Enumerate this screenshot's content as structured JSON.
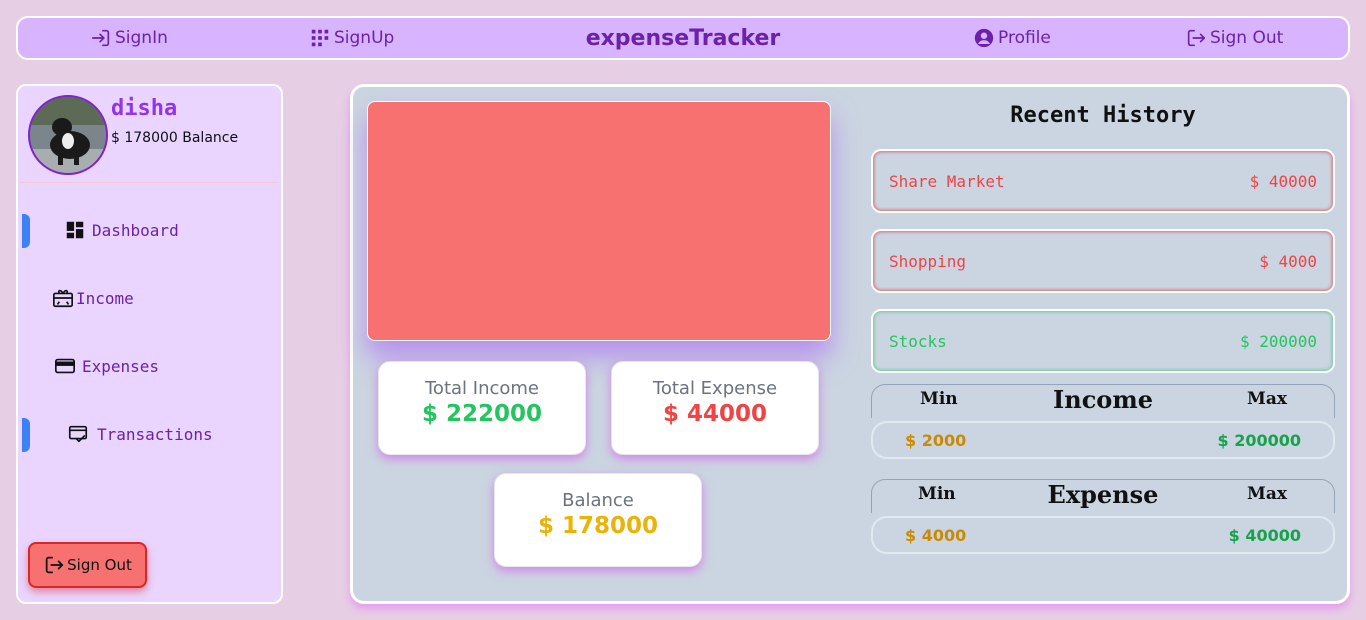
{
  "nav": {
    "signin": "SignIn",
    "signup": "SignUp",
    "brand": "expenseTracker",
    "profile": "Profile",
    "signout": "Sign Out"
  },
  "sidebar": {
    "user_name": "disha",
    "balance_text": "$ 178000 Balance",
    "items": [
      {
        "label": "Dashboard",
        "icon": "dashboard-icon",
        "active": true
      },
      {
        "label": "Income",
        "icon": "gift-card-icon",
        "active": false
      },
      {
        "label": "Expenses",
        "icon": "credit-card-icon",
        "active": false
      },
      {
        "label": "Transactions",
        "icon": "receipt-check-icon",
        "active": true
      }
    ],
    "signout_label": "Sign Out"
  },
  "stats": {
    "income_label": "Total Income",
    "income_value": "$ 222000",
    "expense_label": "Total Expense",
    "expense_value": "$ 44000",
    "balance_label": "Balance",
    "balance_value": "$ 178000"
  },
  "history": {
    "title": "Recent History",
    "items": [
      {
        "name": "Share Market",
        "amount": "$ 40000",
        "type": "expense"
      },
      {
        "name": "Shopping",
        "amount": "$ 4000",
        "type": "expense"
      },
      {
        "name": "Stocks",
        "amount": "$ 200000",
        "type": "income"
      }
    ]
  },
  "income_range": {
    "min_label": "Min",
    "title": "Income",
    "max_label": "Max",
    "min_value": "$ 2000",
    "max_value": "$ 200000"
  },
  "expense_range": {
    "min_label": "Min",
    "title": "Expense",
    "max_label": "Max",
    "min_value": "$ 4000",
    "max_value": "$ 40000"
  },
  "colors": {
    "nav_bg": "#d8b4fe",
    "accent_purple": "#6b21a8",
    "income_green": "#22c55e",
    "expense_red": "#ef4444",
    "balance_gold": "#eab308",
    "chart_placeholder": "#f87171",
    "active_indicator": "#3b82f6"
  }
}
